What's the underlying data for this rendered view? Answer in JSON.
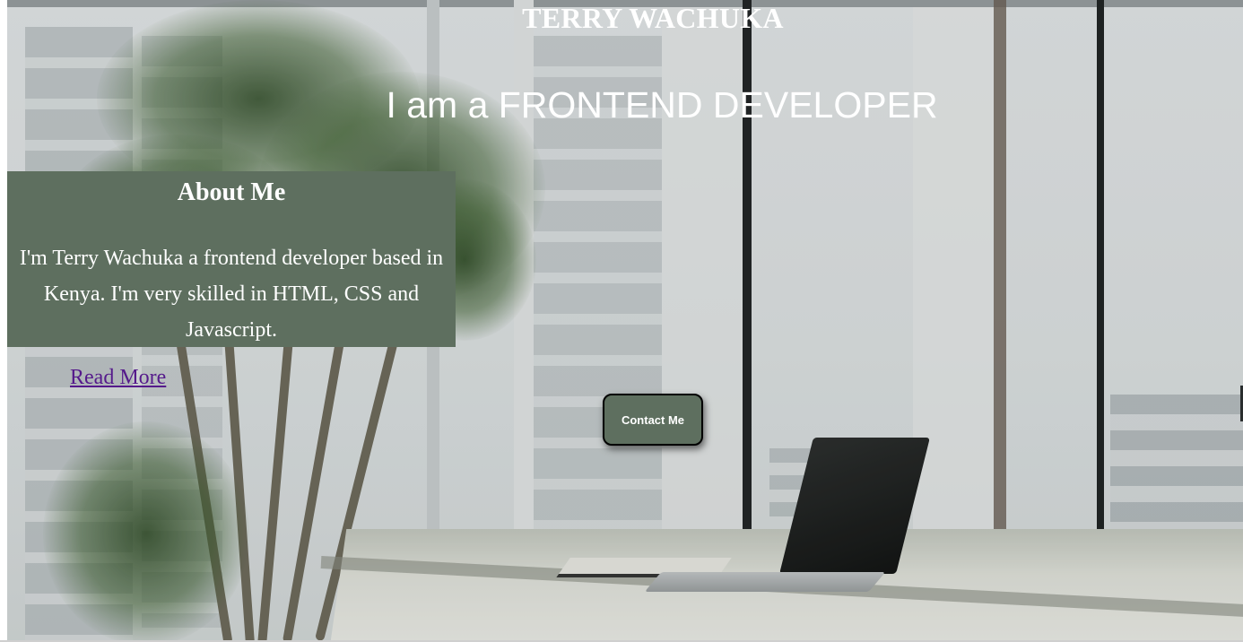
{
  "header": {
    "site_title": "TERRY WACHUKA",
    "tagline": "I am a FRONTEND DEVELOPER"
  },
  "about": {
    "heading": "About Me",
    "body": "I'm Terry Wachuka a frontend developer based in Kenya. I'm very skilled in HTML, CSS and Javascript.",
    "read_more_label": "Read More"
  },
  "contact": {
    "button_label": "Contact Me"
  },
  "colors": {
    "panel_green": "#5e6f5f",
    "title_white": "#ffffff",
    "visited_link": "#551a8b"
  },
  "background": {
    "description_icon": "office-window-photo"
  }
}
